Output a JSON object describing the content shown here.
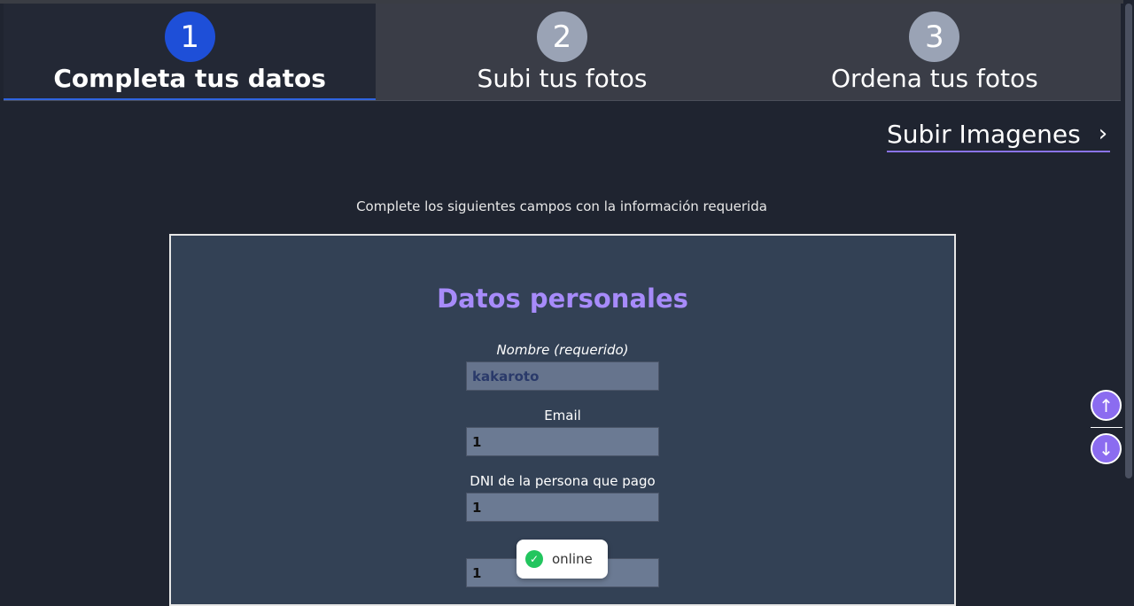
{
  "steps": [
    {
      "number": "1",
      "label": "Completa tus datos"
    },
    {
      "number": "2",
      "label": "Subi tus fotos"
    },
    {
      "number": "3",
      "label": "Ordena tus fotos"
    }
  ],
  "nav": {
    "subir_label": "Subir Imagenes",
    "chevron": "›"
  },
  "instructions": "Complete los siguientes campos con la información requerida",
  "form": {
    "title": "Datos personales",
    "fields": [
      {
        "label": "Nombre (requerido)",
        "value": "kakaroto"
      },
      {
        "label": "Email",
        "value": "1"
      },
      {
        "label": "DNI de la persona que pago",
        "value": "1"
      },
      {
        "label": "",
        "value": "1"
      }
    ]
  },
  "toast": {
    "text": "online",
    "icon": "check-circle-icon"
  },
  "scroll": {
    "up_icon": "↑",
    "down_icon": "↓"
  },
  "colors": {
    "accent": "#a78bfa",
    "active_step": "#1e4fd8",
    "panel": "#334155",
    "background": "#1f2430"
  }
}
